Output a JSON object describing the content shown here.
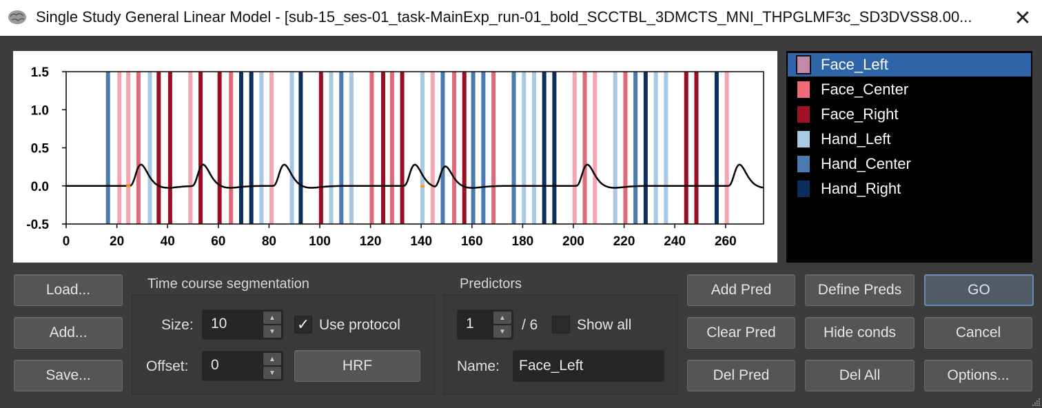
{
  "window": {
    "title": "Single Study General Linear Model - [sub-15_ses-01_task-MainExp_run-01_bold_SCCTBL_3DMCTS_MNI_THPGLMF3c_SD3DVSS8.00..."
  },
  "icons": {
    "app": "brain-icon",
    "close": "close-icon",
    "grip": "resize-grip-icon"
  },
  "chart_data": {
    "type": "line",
    "xlim": [
      0,
      275
    ],
    "ylim": [
      -0.5,
      1.5
    ],
    "x_ticks": [
      "0",
      "20",
      "40",
      "60",
      "80",
      "100",
      "120",
      "140",
      "160",
      "180",
      "200",
      "220",
      "240",
      "260"
    ],
    "y_ticks": [
      "1.5",
      "1.0",
      "0.5",
      "0.0",
      "-0.5"
    ],
    "condition_colors": {
      "Face_Left": "#f4a6b0",
      "Face_Center": "#e06a78",
      "Face_Right": "#9b0d22",
      "Hand_Left": "#a8c8e4",
      "Hand_Center": "#4a7ab0",
      "Hand_Right": "#0b2e5c"
    },
    "events": [
      {
        "t": 16.5,
        "c": "Hand_Center"
      },
      {
        "t": 21,
        "c": "Face_Left"
      },
      {
        "t": 24.5,
        "c": "Face_Left"
      },
      {
        "t": 28.5,
        "c": "Face_Center"
      },
      {
        "t": 33,
        "c": "Hand_Left"
      },
      {
        "t": 36.5,
        "c": "Face_Right"
      },
      {
        "t": 41,
        "c": "Face_Right"
      },
      {
        "t": 49,
        "c": "Face_Left"
      },
      {
        "t": 53,
        "c": "Face_Right"
      },
      {
        "t": 60.5,
        "c": "Face_Right"
      },
      {
        "t": 65,
        "c": "Face_Center"
      },
      {
        "t": 69,
        "c": "Hand_Right"
      },
      {
        "t": 73,
        "c": "Hand_Right"
      },
      {
        "t": 77,
        "c": "Hand_Left"
      },
      {
        "t": 81,
        "c": "Face_Left"
      },
      {
        "t": 89,
        "c": "Hand_Left"
      },
      {
        "t": 92.5,
        "c": "Hand_Right"
      },
      {
        "t": 100.5,
        "c": "Face_Right"
      },
      {
        "t": 104.5,
        "c": "Hand_Left"
      },
      {
        "t": 108.5,
        "c": "Hand_Center"
      },
      {
        "t": 112.5,
        "c": "Hand_Left"
      },
      {
        "t": 120.5,
        "c": "Face_Center"
      },
      {
        "t": 125,
        "c": "Face_Right"
      },
      {
        "t": 128.5,
        "c": "Face_Center"
      },
      {
        "t": 132.5,
        "c": "Face_Right"
      },
      {
        "t": 140.5,
        "c": "Hand_Left"
      },
      {
        "t": 144.5,
        "c": "Face_Left"
      },
      {
        "t": 148.5,
        "c": "Hand_Center"
      },
      {
        "t": 153,
        "c": "Face_Center"
      },
      {
        "t": 157,
        "c": "Face_Right"
      },
      {
        "t": 160.5,
        "c": "Hand_Center"
      },
      {
        "t": 164.5,
        "c": "Hand_Center"
      },
      {
        "t": 168.5,
        "c": "Face_Center"
      },
      {
        "t": 176.5,
        "c": "Hand_Center"
      },
      {
        "t": 180.5,
        "c": "Hand_Left"
      },
      {
        "t": 184.5,
        "c": "Hand_Left"
      },
      {
        "t": 188.5,
        "c": "Hand_Right"
      },
      {
        "t": 192.5,
        "c": "Hand_Right"
      },
      {
        "t": 200.5,
        "c": "Face_Left"
      },
      {
        "t": 204.5,
        "c": "Face_Center"
      },
      {
        "t": 208.5,
        "c": "Face_Left"
      },
      {
        "t": 216.5,
        "c": "Hand_Left"
      },
      {
        "t": 220.5,
        "c": "Face_Center"
      },
      {
        "t": 224.5,
        "c": "Hand_Center"
      },
      {
        "t": 228.5,
        "c": "Hand_Right"
      },
      {
        "t": 232.5,
        "c": "Hand_Left"
      },
      {
        "t": 236.5,
        "c": "Hand_Left"
      },
      {
        "t": 244.5,
        "c": "Face_Right"
      },
      {
        "t": 248.5,
        "c": "Face_Right"
      },
      {
        "t": 256.5,
        "c": "Hand_Right"
      },
      {
        "t": 260.5,
        "c": "Face_Left"
      }
    ],
    "predictor_onsets": [
      24.5,
      49,
      81,
      132.5,
      144.5,
      200.5,
      260.5
    ],
    "predictor_color": "#000000",
    "marker_color": "#ff9900",
    "markers": [
      24.5,
      140.5
    ]
  },
  "legend": {
    "items": [
      {
        "label": "Face_Left",
        "color": "#c08aa8",
        "selected": true
      },
      {
        "label": "Face_Center",
        "color": "#f06a7a",
        "selected": false
      },
      {
        "label": "Face_Right",
        "color": "#a01024",
        "selected": false
      },
      {
        "label": "Hand_Left",
        "color": "#a8c8e4",
        "selected": false
      },
      {
        "label": "Hand_Center",
        "color": "#4a7ab0",
        "selected": false
      },
      {
        "label": "Hand_Right",
        "color": "#0b2e5c",
        "selected": false
      }
    ]
  },
  "buttons": {
    "load": "Load...",
    "add": "Add...",
    "save": "Save...",
    "hrf": "HRF",
    "add_pred": "Add Pred",
    "define_preds": "Define Preds",
    "go": "GO",
    "clear_pred": "Clear Pred",
    "hide_conds": "Hide conds",
    "cancel": "Cancel",
    "del_pred": "Del Pred",
    "del_all": "Del All",
    "options": "Options..."
  },
  "segmentation": {
    "group_label": "Time course segmentation",
    "size_label": "Size:",
    "size_value": "10",
    "offset_label": "Offset:",
    "offset_value": "0",
    "use_protocol_label": "Use protocol",
    "use_protocol_checked": "✓"
  },
  "predictors": {
    "group_label": "Predictors",
    "current": "1",
    "total": "/ 6",
    "show_all_label": "Show all",
    "show_all_checked": "",
    "name_label": "Name:",
    "name_value": "Face_Left"
  }
}
